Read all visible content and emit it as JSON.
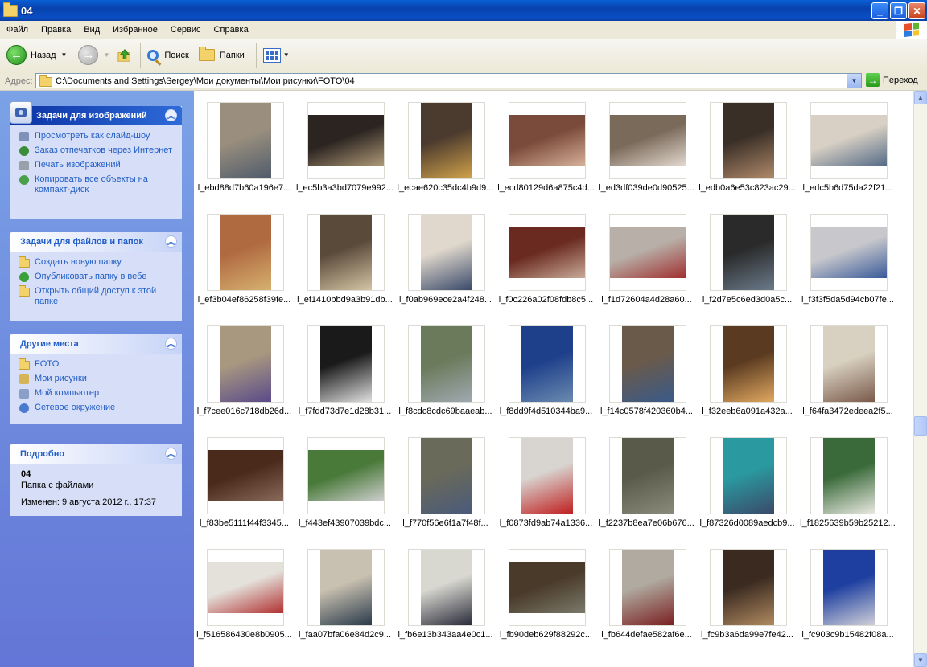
{
  "window": {
    "title": "04"
  },
  "menu": [
    "Файл",
    "Правка",
    "Вид",
    "Избранное",
    "Сервис",
    "Справка"
  ],
  "toolbar": {
    "back": "Назад",
    "search": "Поиск",
    "folders": "Папки"
  },
  "address": {
    "label": "Адрес:",
    "path": "C:\\Documents and Settings\\Sergey\\Мои документы\\Мои рисунки\\FOTO\\04",
    "go": "Переход"
  },
  "panels": {
    "image_tasks": {
      "title": "Задачи для изображений",
      "links": [
        "Просмотреть как слайд-шоу",
        "Заказ отпечатков через Интернет",
        "Печать изображений",
        "Копировать все объекты на компакт-диск"
      ]
    },
    "file_tasks": {
      "title": "Задачи для файлов и папок",
      "links": [
        "Создать новую папку",
        "Опубликовать папку в вебе",
        "Открыть общий доступ к этой папке"
      ]
    },
    "other_places": {
      "title": "Другие места",
      "links": [
        "FOTO",
        "Мои рисунки",
        "Мой компьютер",
        "Сетевое окружение"
      ]
    },
    "details": {
      "title": "Подробно",
      "name": "04",
      "type": "Папка с файлами",
      "modified": "Изменен: 9 августа 2012 г., 17:37"
    }
  },
  "files": [
    "l_ebd88d7b60a196e7...",
    "l_ec5b3a3bd7079e992...",
    "l_ecae620c35dc4b9d9...",
    "l_ecd80129d6a875c4d...",
    "l_ed3df039de0d90525...",
    "l_edb0a6e53c823ac29...",
    "l_edc5b6d75da22f21...",
    "l_ef3b04ef86258f39fe...",
    "l_ef1410bbd9a3b91db...",
    "l_f0ab969ece2a4f248...",
    "l_f0c226a02f08fdb8c5...",
    "l_f1d72604a4d28a60...",
    "l_f2d7e5c6ed3d0a5c...",
    "l_f3f3f5da5d94cb07fe...",
    "l_f7cee016c718db26d...",
    "l_f7fdd73d7e1d28b31...",
    "l_f8cdc8cdc69baaeab...",
    "l_f8dd9f4d510344ba9...",
    "l_f14c0578f420360b4...",
    "l_f32eeb6a091a432a...",
    "l_f64fa3472edeea2f5...",
    "l_f83be5111f44f3345...",
    "l_f443ef43907039bdc...",
    "l_f770f56e6f1a7f48f...",
    "l_f0873fd9ab74a1336...",
    "l_f2237b8ea7e06b676...",
    "l_f87326d0089aedcb9...",
    "l_f1825639b59b25212...",
    "l_f516586430e8b0905...",
    "l_faa07bfa06e84d2c9...",
    "l_fb6e13b343aa4e0c1...",
    "l_fb90deb629f88292c...",
    "l_fb644defae582af6e...",
    "l_fc9b3a6da99e7fe42...",
    "l_fc903c9b15482f08a..."
  ],
  "thumb_colors": [
    [
      "#9a8f7e",
      "#4f5b6b"
    ],
    [
      "#2b2420",
      "#b09a78"
    ],
    [
      "#4b3a2e",
      "#d1a24a"
    ],
    [
      "#7a4a3a",
      "#d7b29a"
    ],
    [
      "#7a6a5a",
      "#e4dad0"
    ],
    [
      "#3a2f27",
      "#b08a6a"
    ],
    [
      "#d8d0c4",
      "#546a86"
    ],
    [
      "#b06a40",
      "#d6b070"
    ],
    [
      "#5a4a3a",
      "#d4c4a4"
    ],
    [
      "#e0d8cc",
      "#3a4a6a"
    ],
    [
      "#6a2a20",
      "#c8aa98"
    ],
    [
      "#b8b0a8",
      "#a03030"
    ],
    [
      "#2a2a2a",
      "#6a7a8a"
    ],
    [
      "#c8c8cc",
      "#3a5a9a"
    ],
    [
      "#a89880",
      "#5a4a8a"
    ],
    [
      "#1a1a1a",
      "#e0e0e0"
    ],
    [
      "#6a7a5a",
      "#a0a8b0"
    ],
    [
      "#1e3f8a",
      "#6a8ab0"
    ],
    [
      "#6a5a4a",
      "#3a5a8a"
    ],
    [
      "#5a3a20",
      "#e0a860"
    ],
    [
      "#d8d0c0",
      "#7a5a4a"
    ],
    [
      "#4a2a1a",
      "#8a6a5a"
    ],
    [
      "#4a7a3a",
      "#cfcfcf"
    ],
    [
      "#6a6a5a",
      "#4a5a7a"
    ],
    [
      "#d8d4d0",
      "#c02020"
    ],
    [
      "#5a5a4a",
      "#8a8a7a"
    ],
    [
      "#2a9aa0",
      "#3a4a6a"
    ],
    [
      "#3a6a3a",
      "#e8e8e0"
    ],
    [
      "#e4e0da",
      "#b03030"
    ],
    [
      "#c8c0b0",
      "#2a3a4a"
    ],
    [
      "#d8d8d0",
      "#2a2a3a"
    ],
    [
      "#4a3a2a",
      "#7a7a6a"
    ],
    [
      "#b0aaa0",
      "#7a2020"
    ],
    [
      "#3a2a20",
      "#b08a60"
    ],
    [
      "#1e3fa0",
      "#d0d0d8"
    ]
  ],
  "thumb_shapes": [
    "portrait",
    "landscape",
    "portrait",
    "landscape",
    "landscape",
    "portrait",
    "landscape",
    "portrait",
    "portrait",
    "portrait",
    "landscape",
    "landscape",
    "portrait",
    "landscape",
    "portrait",
    "portrait",
    "portrait",
    "portrait",
    "portrait",
    "portrait",
    "portrait",
    "landscape",
    "landscape",
    "portrait",
    "portrait",
    "portrait",
    "portrait",
    "portrait",
    "landscape",
    "portrait",
    "portrait",
    "landscape",
    "portrait",
    "portrait",
    "portrait"
  ]
}
